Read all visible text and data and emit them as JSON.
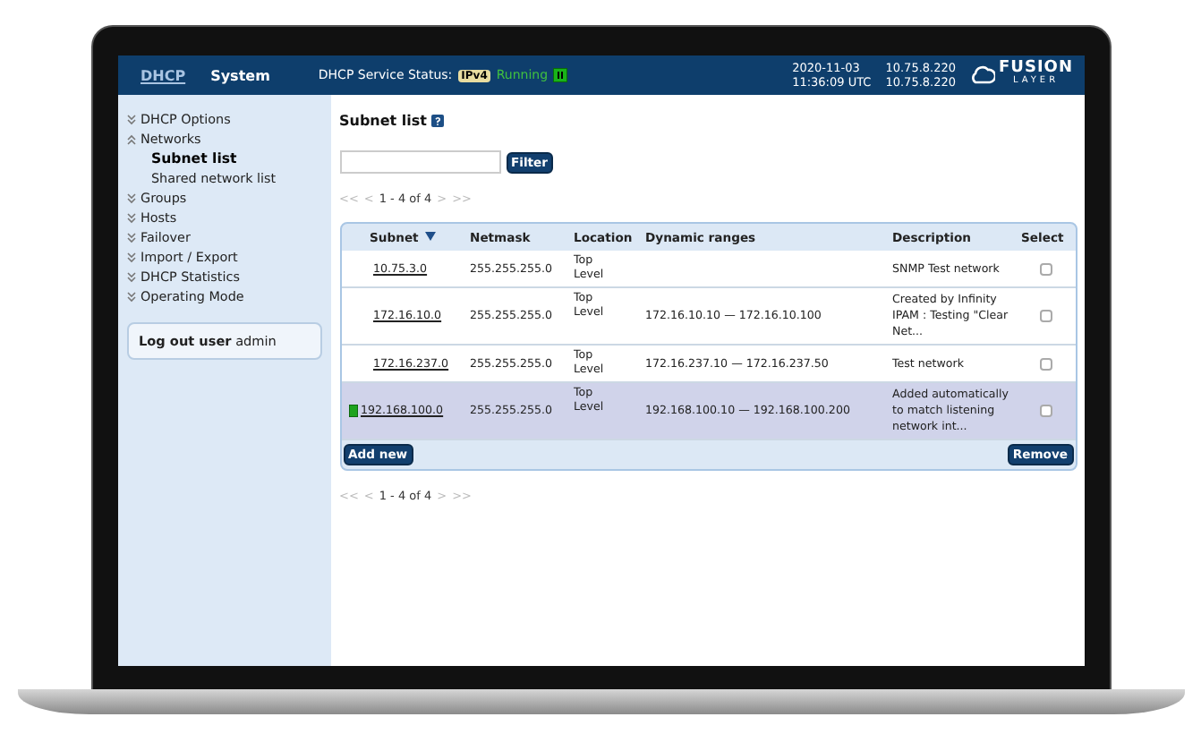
{
  "header": {
    "tabs": [
      {
        "label": "DHCP",
        "selected": false
      },
      {
        "label": "System",
        "selected": true
      }
    ],
    "status_label": "DHCP Service Status:",
    "protocol_badge": "IPv4",
    "status": "Running",
    "date": "2020-11-03",
    "time": "11:36:09 UTC",
    "addresses": [
      "10.75.8.220",
      "10.75.8.220"
    ],
    "logo": {
      "top": "FUSION",
      "bottom": "LAYER"
    }
  },
  "sidebar": {
    "items": [
      {
        "label": "DHCP Options",
        "expanded": false
      },
      {
        "label": "Networks",
        "expanded": true,
        "children": [
          {
            "label": "Subnet list",
            "selected": true
          },
          {
            "label": "Shared network list",
            "selected": false
          }
        ]
      },
      {
        "label": "Groups",
        "expanded": false
      },
      {
        "label": "Hosts",
        "expanded": false
      },
      {
        "label": "Failover",
        "expanded": false
      },
      {
        "label": "Import / Export",
        "expanded": false
      },
      {
        "label": "DHCP Statistics",
        "expanded": false
      },
      {
        "label": "Operating Mode",
        "expanded": false
      }
    ],
    "logout": {
      "label": "Log out user",
      "user": "admin"
    }
  },
  "page_title": "Subnet list",
  "filter": {
    "button": "Filter"
  },
  "pager_top": {
    "first": "<<",
    "prev": "<",
    "range": "1 - 4 of 4",
    "next": ">",
    "last": ">>",
    "disabled": true
  },
  "table": {
    "columns": [
      {
        "label": "Subnet",
        "sorted": true
      },
      {
        "label": "Netmask",
        "sorted": false
      },
      {
        "label": "Location",
        "sorted": false
      },
      {
        "label": "Dynamic ranges",
        "sorted": false
      },
      {
        "label": "Description",
        "sorted": false
      },
      {
        "label": "Select",
        "sorted": false
      }
    ],
    "rows": [
      {
        "subnet": "10.75.3.0",
        "netmask": "255.255.255.0",
        "location": "Top Level",
        "description": "SNMP Test network",
        "checked": false,
        "selected": false,
        "listening": false
      },
      {
        "subnet": "172.16.10.0",
        "netmask": "255.255.255.0",
        "location": "Top Level",
        "range": "172.16.10.10 — 172.16.10.100",
        "description": "Created by Infinity IPAM : Testing \"Clear Net...",
        "checked": false,
        "selected": false,
        "listening": false
      },
      {
        "subnet": "172.16.237.0",
        "netmask": "255.255.255.0",
        "location": "Top Level",
        "range": "172.16.237.10 — 172.16.237.50",
        "description": "Test network",
        "checked": false,
        "selected": false,
        "listening": false
      },
      {
        "subnet": "192.168.100.0",
        "netmask": "255.255.255.0",
        "location": "Top Level",
        "range": "192.168.100.10 — 192.168.100.200",
        "description": "Added automatically to match listening network int...",
        "checked": false,
        "selected": true,
        "listening": true
      }
    ],
    "add_button": "Add new",
    "remove_button": "Remove"
  },
  "pager_bottom": {
    "first": "<<",
    "prev": "<",
    "range": "1 - 4 of 4",
    "next": ">",
    "last": ">>",
    "disabled": true
  }
}
